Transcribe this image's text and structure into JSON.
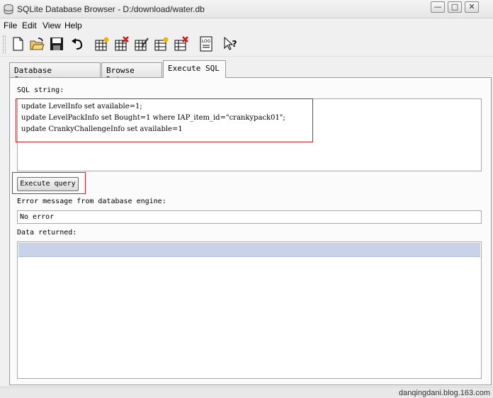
{
  "window": {
    "title": "SQLite Database Browser - D:/download/water.db",
    "minimize": "—",
    "maximize": "□",
    "close": "✕"
  },
  "menu": [
    "File",
    "Edit",
    "View",
    "Help"
  ],
  "toolbar": {
    "icons": [
      "new-database-icon",
      "open-database-icon",
      "save-icon",
      "undo-icon",
      "create-table-icon",
      "delete-table-icon",
      "modify-table-icon",
      "create-index-icon",
      "delete-index-icon",
      "sql-log-icon",
      "whats-this-help-icon"
    ]
  },
  "tabs": [
    "Database Structure",
    "Browse Data",
    "Execute SQL"
  ],
  "active_tab": "Execute SQL",
  "execute_sql": {
    "sql_label": "SQL string:",
    "sql_lines": [
      "update LevelInfo set available=1;",
      "update LevelPackInfo set Bought=1 where IAP_item_id=\"crankypack01\";",
      "update CrankyChallengeInfo set available=1"
    ],
    "execute_button": "Execute query",
    "error_label": "Error message from database engine:",
    "error_value": "No error",
    "data_label": "Data returned:"
  },
  "watermark": "danqingdani.blog.163.com",
  "colors": {
    "highlight_border": "#d21e1e",
    "grid_header": "#c8d3ea"
  }
}
